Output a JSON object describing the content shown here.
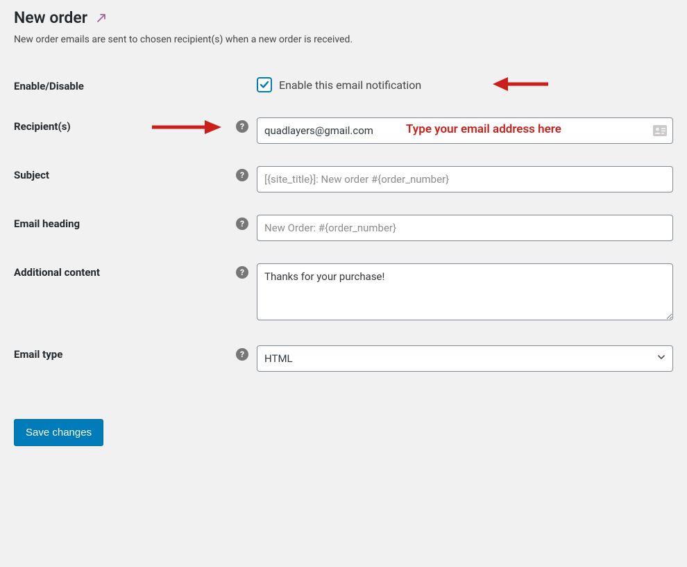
{
  "page": {
    "title": "New order",
    "description": "New order emails are sent to chosen recipient(s) when a new order is received."
  },
  "fields": {
    "enable": {
      "label": "Enable/Disable",
      "checkbox_label": "Enable this email notification",
      "checked": true
    },
    "recipient": {
      "label": "Recipient(s)",
      "value": "quadlayers@gmail.com",
      "placeholder": ""
    },
    "subject": {
      "label": "Subject",
      "value": "",
      "placeholder": "[{site_title}]: New order #{order_number}"
    },
    "heading": {
      "label": "Email heading",
      "value": "",
      "placeholder": "New Order: #{order_number}"
    },
    "additional": {
      "label": "Additional content",
      "value": "Thanks for your purchase!",
      "placeholder": ""
    },
    "email_type": {
      "label": "Email type",
      "selected": "HTML"
    }
  },
  "annotations": {
    "recipient_hint": "Type your email address here"
  },
  "buttons": {
    "save": "Save changes"
  },
  "help_glyph": "?"
}
